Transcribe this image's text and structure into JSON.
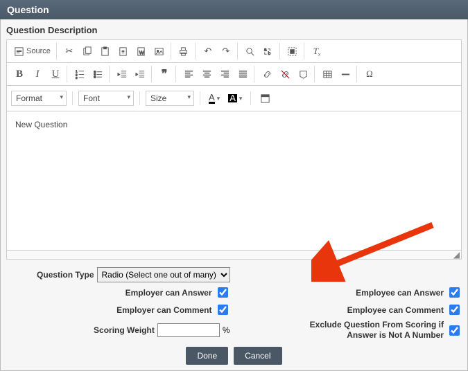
{
  "header": {
    "title": "Question"
  },
  "section": {
    "description_label": "Question Description"
  },
  "toolbar": {
    "source_label": "Source",
    "format_label": "Format",
    "font_label": "Font",
    "size_label": "Size"
  },
  "editor": {
    "content": "New Question"
  },
  "form": {
    "question_type_label": "Question Type",
    "question_type_value": "Radio (Select one out of many)",
    "employer_answer_label": "Employer can Answer",
    "employer_answer_checked": true,
    "employee_answer_label": "Employee can Answer",
    "employee_answer_checked": true,
    "employer_comment_label": "Employer can Comment",
    "employer_comment_checked": true,
    "employee_comment_label": "Employee can Comment",
    "employee_comment_checked": true,
    "scoring_weight_label": "Scoring Weight",
    "scoring_weight_value": "",
    "scoring_weight_unit": "%",
    "exclude_label": "Exclude Question From Scoring if Answer is Not A Number",
    "exclude_checked": true
  },
  "buttons": {
    "done": "Done",
    "cancel": "Cancel"
  }
}
